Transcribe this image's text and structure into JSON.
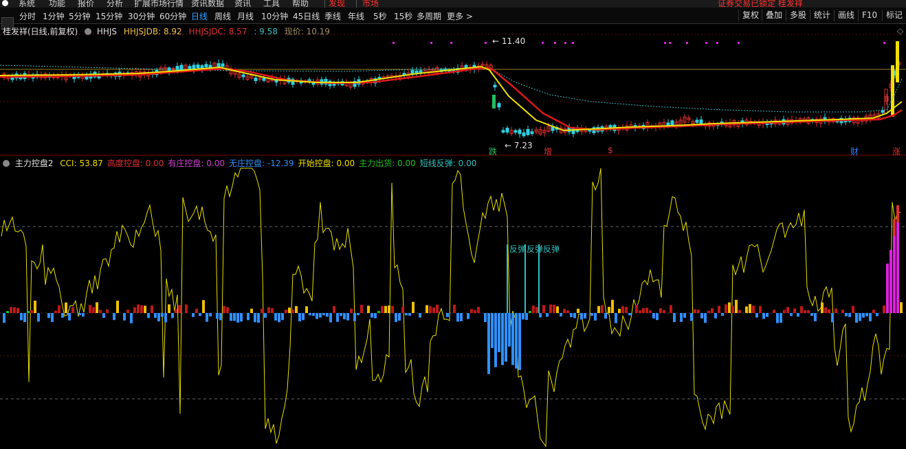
{
  "menu": {
    "items": [
      "系统",
      "功能",
      "报价",
      "分析",
      "扩展市场行情",
      "资讯数据",
      "资讯",
      "工具",
      "帮助"
    ],
    "discover": "发现",
    "market": "市场",
    "notice": "证券交易已锁定  桂发祥"
  },
  "periods": {
    "items": [
      "分时",
      "1分钟",
      "5分钟",
      "15分钟",
      "30分钟",
      "60分钟",
      "日线",
      "周线",
      "月线",
      "10分钟",
      "45日线",
      "季线",
      "年线",
      "5秒",
      "15秒",
      "多周期",
      "更多 >"
    ],
    "active": "日线"
  },
  "tools": [
    "复权",
    "叠加",
    "多股",
    "统计",
    "画线",
    "F10",
    "标记"
  ],
  "chart_data": [
    {
      "type": "candlestick",
      "title": "桂发祥(日线,前复权)",
      "indicators": [
        {
          "name": "HHJS",
          "value": ""
        },
        {
          "name": "HHJSJDB",
          "value": "8.92",
          "color": "#f0c040"
        },
        {
          "name": "HHJSJDC",
          "value": "8.57",
          "color": "#e03030"
        },
        {
          "name": "",
          "value": "9.58",
          "color": "#30c0c0"
        },
        {
          "name": "现价",
          "value": "10.19",
          "color": "#a09060"
        }
      ],
      "annotations": {
        "high": "11.40",
        "low": "7.23"
      },
      "signals": [
        "跌",
        "增",
        "$",
        "财",
        "涨"
      ],
      "signal_colors": {
        "跌": "#20c060",
        "增": "#e03030",
        "$": "#e03030",
        "财": "#3080ff",
        "涨": "#e03030"
      },
      "colors": {
        "up": "#e03030",
        "down": "#30d0e0",
        "ma_fast": "#f0e000",
        "ma_slow": "#e01818",
        "ma_long": "#30c0c0"
      }
    },
    {
      "type": "bar",
      "title": "主力控盘2",
      "indicators": [
        {
          "name": "CCI",
          "value": "53.87",
          "color": "#f0e000"
        },
        {
          "name": "高度控盘",
          "value": "0.00",
          "color": "#e03030"
        },
        {
          "name": "有庄控盘",
          "value": "0.00",
          "color": "#d040d0"
        },
        {
          "name": "无庄控盘",
          "value": "-12.39",
          "color": "#3090ff"
        },
        {
          "name": "开始控盘",
          "value": "0.00",
          "color": "#f0e000"
        },
        {
          "name": "主力出货",
          "value": "0.00",
          "color": "#20c020"
        },
        {
          "name": "短线反弹",
          "value": "0.00",
          "color": "#30c0c0"
        }
      ],
      "rebound_labels": [
        "反弹",
        "反弹",
        "反弹"
      ]
    }
  ]
}
